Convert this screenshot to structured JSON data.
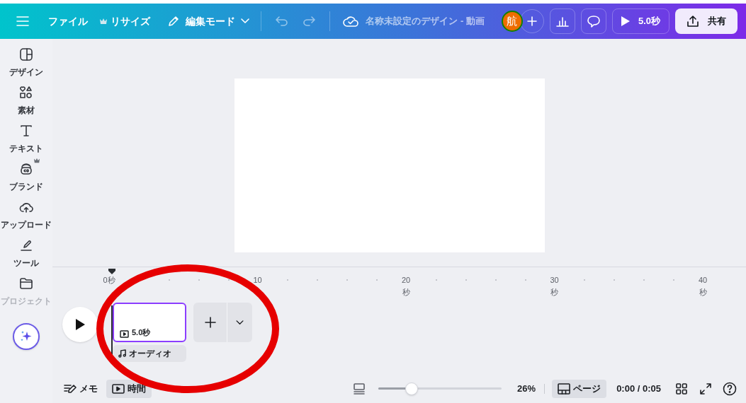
{
  "topbar": {
    "menu": [
      {
        "label": "ファイル",
        "kind": "plain"
      },
      {
        "label": "リサイズ",
        "kind": "crown"
      }
    ],
    "edit_mode": "編集モード",
    "title": "名称未設定のデザイン - 動画",
    "avatar": "航",
    "play_duration": "5.0秒",
    "share": "共有"
  },
  "sidebar": {
    "items": [
      {
        "label": "デザイン",
        "disabled": false
      },
      {
        "label": "素材",
        "disabled": false
      },
      {
        "label": "テキスト",
        "disabled": false
      },
      {
        "label": "ブランド",
        "disabled": false
      },
      {
        "label": "アップロード",
        "disabled": false
      },
      {
        "label": "ツール",
        "disabled": false
      },
      {
        "label": "プロジェクト",
        "disabled": true
      }
    ]
  },
  "timeline": {
    "ticks": [
      {
        "label": "0秒"
      },
      {
        "label": "10"
      },
      {
        "label": "20",
        "unit": "秒"
      },
      {
        "label": "30",
        "unit": "秒"
      },
      {
        "label": "40",
        "unit": "秒"
      }
    ],
    "clip": {
      "duration": "5.0秒",
      "selected": true
    },
    "audio": "オーディオ"
  },
  "footer": {
    "notes": "メモ",
    "timer": {
      "label": "時間",
      "selected": true
    },
    "zoom": {
      "level": 0.27,
      "reading": "26%"
    },
    "page_view": {
      "label": "ページ",
      "selected": true
    },
    "time": "0:00 / 0:05"
  }
}
